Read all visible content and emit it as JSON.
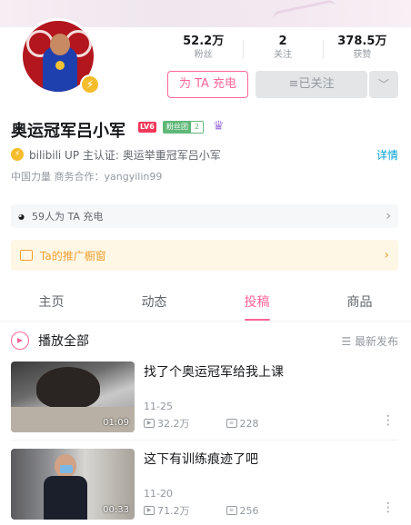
{
  "profile": {
    "followers_count": "52.2万",
    "followers_label": "粉丝",
    "following_count": "2",
    "following_label": "关注",
    "likes_count": "378.5万",
    "likes_label": "获赞",
    "charge_button": "为 TA 充电",
    "follow_button": "≡已关注",
    "more_button": "﹀",
    "name": "奥运冠军吕小军",
    "level_badge": "LV6",
    "fanclub_label": "粉丝团",
    "fanclub_level": "2",
    "cert_text": "bilibili UP 主认证: 奥运举重冠军吕小军",
    "detail_link": "详情",
    "signature": "中国力量 商务合作：yangyilin99",
    "charge_row_text": "59人为 TA 充电",
    "shop_row_text": "Ta的推广橱窗"
  },
  "tabs": [
    "主页",
    "动态",
    "投稿",
    "商品"
  ],
  "active_tab": "投稿",
  "playlist": {
    "play_all": "播放全部",
    "sort": "☰ 最新发布"
  },
  "videos": [
    {
      "title": "找了个奥运冠军给我上课",
      "duration": "01:09",
      "date": "11-25",
      "views": "32.2万",
      "comments": "228"
    },
    {
      "title": "这下有训练痕迹了吧",
      "duration": "00:33",
      "date": "11-20",
      "views": "71.2万",
      "comments": "256"
    }
  ],
  "colors": {
    "accent": "#ff6699",
    "link": "#00a1d6",
    "shop": "#f0a030"
  }
}
